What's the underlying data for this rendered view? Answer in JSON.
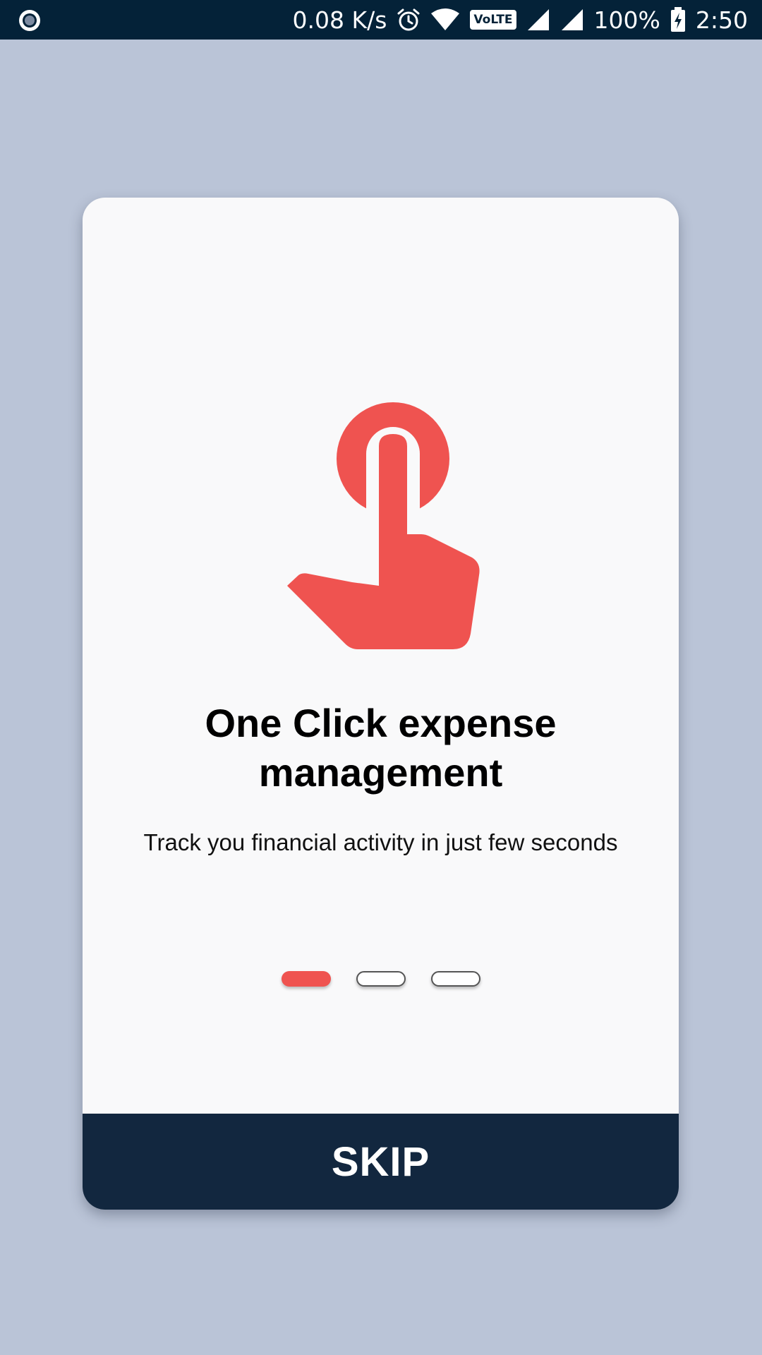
{
  "status_bar": {
    "network_speed": "0.08 K/s",
    "volte_label": "VoLTE",
    "battery_percent": "100%",
    "time": "2:50",
    "icons": [
      "app-notification-icon",
      "alarm-icon",
      "wifi-icon",
      "volte-icon",
      "signal-icon",
      "signal-icon",
      "battery-charging-icon"
    ]
  },
  "onboarding": {
    "hero_icon": "tap-hand-icon",
    "title_line1": "One Click expense",
    "title_line2": "management",
    "subtitle": "Track you financial activity in just few seconds",
    "pager": {
      "total_pages": 3,
      "current_page": 1
    },
    "skip_label": "SKIP"
  },
  "colors": {
    "background": "#bac4d7",
    "status_bar": "#042238",
    "card": "#f9f9fa",
    "accent": "#ef5350",
    "skip_button": "#12273f"
  }
}
